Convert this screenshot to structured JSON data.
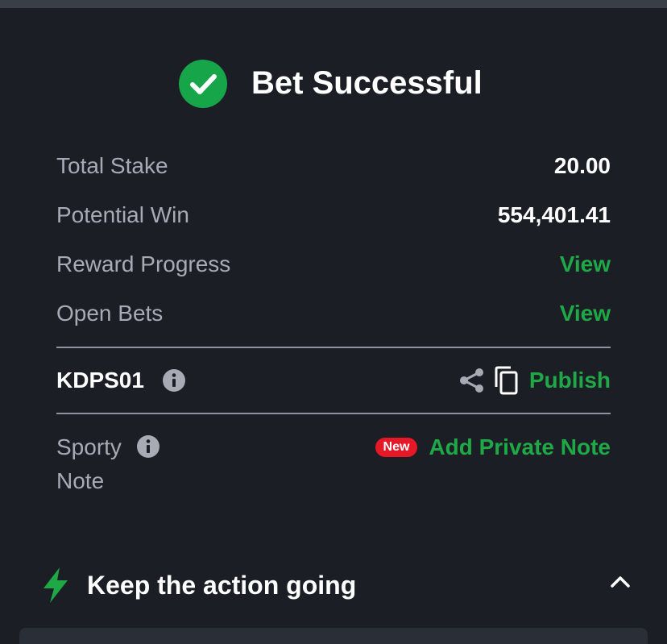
{
  "header": {
    "title": "Bet Successful",
    "icon": "check-circle-icon",
    "accent": "#17a54a"
  },
  "summary": [
    {
      "label": "Total Stake",
      "value": "20.00"
    },
    {
      "label": "Potential Win",
      "value": "554,401.41"
    },
    {
      "label": "Reward Progress",
      "link": "View"
    },
    {
      "label": "Open Bets",
      "link": "View"
    }
  ],
  "booking": {
    "code": "KDPS01",
    "info_icon": "info-icon",
    "share_icon": "share-icon",
    "copy_icon": "copy-icon",
    "publish_label": "Publish"
  },
  "note": {
    "label": "Sporty Note",
    "badge": "New",
    "action": "Add Private Note"
  },
  "section": {
    "title": "Keep the action going",
    "icon": "lightning-bolt-icon",
    "toggle_icon": "chevron-up-icon"
  },
  "colors": {
    "background": "#1b1e25",
    "link_green": "#1fa846",
    "badge_red": "#e41827",
    "muted_text": "#a8abb3"
  }
}
